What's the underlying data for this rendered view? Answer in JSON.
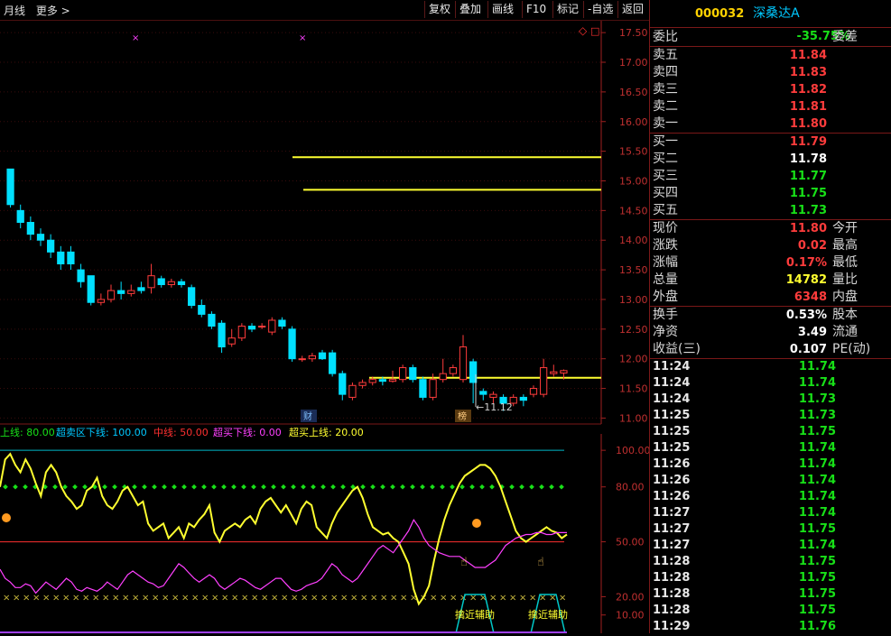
{
  "toolbar": {
    "period": "月线",
    "more": "更多 >",
    "buttons": [
      "复权",
      "叠加",
      "画线",
      "F10",
      "标记",
      "-自选",
      "返回"
    ]
  },
  "stock": {
    "code": "000032",
    "name": "深桑达A"
  },
  "weibi": {
    "label": "委比",
    "value": "-35.75%",
    "label2": "委差"
  },
  "asks": [
    {
      "label": "卖五",
      "price": "11.84"
    },
    {
      "label": "卖四",
      "price": "11.83"
    },
    {
      "label": "卖三",
      "price": "11.82"
    },
    {
      "label": "卖二",
      "price": "11.81"
    },
    {
      "label": "卖一",
      "price": "11.80"
    }
  ],
  "bids": [
    {
      "label": "买一",
      "price": "11.79"
    },
    {
      "label": "买二",
      "price": "11.78"
    },
    {
      "label": "买三",
      "price": "11.77"
    },
    {
      "label": "买四",
      "price": "11.75"
    },
    {
      "label": "买五",
      "price": "11.73"
    }
  ],
  "quote": [
    {
      "label": "现价",
      "value": "11.80",
      "label2": "今开",
      "color": "red"
    },
    {
      "label": "涨跌",
      "value": "0.02",
      "label2": "最高",
      "color": "red"
    },
    {
      "label": "涨幅",
      "value": "0.17%",
      "label2": "最低",
      "color": "red"
    },
    {
      "label": "总量",
      "value": "14782",
      "label2": "量比",
      "color": "yellow"
    },
    {
      "label": "外盘",
      "value": "6348",
      "label2": "内盘",
      "color": "red"
    }
  ],
  "fund": [
    {
      "label": "换手",
      "value": "0.53%",
      "label2": "股本"
    },
    {
      "label": "净资",
      "value": "3.49",
      "label2": "流通"
    },
    {
      "label": "收益(三)",
      "value": "0.107",
      "label2": "PE(动)"
    }
  ],
  "ticks": [
    {
      "time": "11:24",
      "price": "11.74"
    },
    {
      "time": "11:24",
      "price": "11.74"
    },
    {
      "time": "11:24",
      "price": "11.73"
    },
    {
      "time": "11:25",
      "price": "11.73"
    },
    {
      "time": "11:25",
      "price": "11.75"
    },
    {
      "time": "11:25",
      "price": "11.74"
    },
    {
      "time": "11:26",
      "price": "11.74"
    },
    {
      "time": "11:26",
      "price": "11.74"
    },
    {
      "time": "11:26",
      "price": "11.74"
    },
    {
      "time": "11:27",
      "price": "11.74"
    },
    {
      "time": "11:27",
      "price": "11.75"
    },
    {
      "time": "11:27",
      "price": "11.74"
    },
    {
      "time": "11:28",
      "price": "11.75"
    },
    {
      "time": "11:28",
      "price": "11.75"
    },
    {
      "time": "11:28",
      "price": "11.75"
    },
    {
      "time": "11:28",
      "price": "11.75"
    },
    {
      "time": "11:29",
      "price": "11.76"
    }
  ],
  "indicator": {
    "legend": [
      {
        "text": "上线: 80.00",
        "color": "#18e018"
      },
      {
        "text": "超卖区下线: 100.00",
        "color": "#00c8ff"
      },
      {
        "text": "中线: 50.00",
        "color": "#ff3030"
      },
      {
        "text": "超买下线: 0.00",
        "color": "#ff40ff"
      },
      {
        "text": "超买上线: 20.00",
        "color": "#ffff30"
      }
    ],
    "signal_label": "擒近辅助"
  },
  "annotations": {
    "low_price": "←11.12",
    "marker_cai": "财",
    "marker_bang": "榜"
  },
  "chart_data": [
    {
      "type": "candlestick",
      "title": "",
      "yticks": [
        11.0,
        11.5,
        12.0,
        12.5,
        13.0,
        13.5,
        14.0,
        14.5,
        15.0,
        15.5,
        16.0,
        16.5,
        17.0,
        17.5
      ],
      "ylim": [
        10.9,
        17.7
      ],
      "hlines": [
        15.4,
        14.85,
        11.68
      ],
      "candles": [
        [
          15.2,
          14.6,
          15.2,
          14.55
        ],
        [
          14.5,
          14.3,
          14.6,
          14.2
        ],
        [
          14.3,
          14.1,
          14.4,
          14.0
        ],
        [
          14.1,
          14.0,
          14.2,
          13.9
        ],
        [
          14.0,
          13.8,
          14.1,
          13.7
        ],
        [
          13.8,
          13.6,
          13.9,
          13.5
        ],
        [
          13.8,
          13.6,
          13.9,
          13.5
        ],
        [
          13.5,
          13.3,
          13.6,
          13.2
        ],
        [
          13.4,
          12.95,
          13.4,
          12.9
        ],
        [
          12.95,
          13.0,
          13.1,
          12.9
        ],
        [
          13.0,
          13.15,
          13.25,
          12.95
        ],
        [
          13.15,
          13.1,
          13.3,
          13.0
        ],
        [
          13.1,
          13.15,
          13.25,
          13.05
        ],
        [
          13.2,
          13.15,
          13.3,
          13.1
        ],
        [
          13.2,
          13.4,
          13.6,
          13.1
        ],
        [
          13.35,
          13.25,
          13.4,
          13.2
        ],
        [
          13.25,
          13.3,
          13.35,
          13.2
        ],
        [
          13.3,
          13.25,
          13.35,
          13.2
        ],
        [
          13.2,
          12.9,
          13.25,
          12.85
        ],
        [
          12.9,
          12.75,
          13.0,
          12.7
        ],
        [
          12.75,
          12.55,
          12.8,
          12.5
        ],
        [
          12.6,
          12.2,
          12.65,
          12.1
        ],
        [
          12.25,
          12.35,
          12.5,
          12.2
        ],
        [
          12.35,
          12.55,
          12.6,
          12.3
        ],
        [
          12.55,
          12.5,
          12.6,
          12.45
        ],
        [
          12.55,
          12.55,
          12.6,
          12.5
        ],
        [
          12.45,
          12.65,
          12.7,
          12.4
        ],
        [
          12.65,
          12.55,
          12.7,
          12.5
        ],
        [
          12.5,
          12.0,
          12.55,
          11.95
        ],
        [
          12.0,
          12.0,
          12.05,
          11.95
        ],
        [
          12.0,
          12.05,
          12.1,
          11.95
        ],
        [
          12.1,
          12.0,
          12.15,
          11.98
        ],
        [
          12.1,
          11.75,
          12.15,
          11.7
        ],
        [
          11.75,
          11.4,
          11.8,
          11.3
        ],
        [
          11.35,
          11.55,
          11.6,
          11.3
        ],
        [
          11.55,
          11.6,
          11.65,
          11.5
        ],
        [
          11.6,
          11.65,
          11.7,
          11.55
        ],
        [
          11.65,
          11.62,
          11.7,
          11.55
        ],
        [
          11.62,
          11.65,
          11.8,
          11.6
        ],
        [
          11.65,
          11.85,
          11.9,
          11.6
        ],
        [
          11.85,
          11.65,
          11.9,
          11.6
        ],
        [
          11.65,
          11.35,
          11.7,
          11.3
        ],
        [
          11.35,
          11.65,
          11.75,
          11.3
        ],
        [
          11.65,
          11.75,
          12.0,
          11.6
        ],
        [
          11.75,
          11.85,
          11.9,
          11.7
        ],
        [
          11.65,
          12.2,
          12.4,
          11.6
        ],
        [
          11.95,
          11.6,
          12.0,
          11.25
        ],
        [
          11.45,
          11.4,
          11.5,
          11.3
        ],
        [
          11.35,
          11.4,
          11.45,
          11.25
        ],
        [
          11.35,
          11.25,
          11.4,
          11.12
        ],
        [
          11.25,
          11.35,
          11.4,
          11.2
        ],
        [
          11.35,
          11.3,
          11.4,
          11.2
        ],
        [
          11.4,
          11.5,
          11.55,
          11.35
        ],
        [
          11.4,
          11.85,
          12.0,
          11.35
        ],
        [
          11.75,
          11.78,
          11.9,
          11.7
        ],
        [
          11.76,
          11.8,
          11.82,
          11.65
        ]
      ]
    },
    {
      "type": "line",
      "title": "",
      "yticks": [
        10.0,
        20.0,
        50.0,
        80.0,
        100.0
      ],
      "ylim": [
        0,
        105
      ],
      "hlines": [
        100,
        80,
        50,
        20
      ],
      "series": [
        {
          "color": "#ffff30",
          "values": [
            80,
            95,
            98,
            92,
            88,
            95,
            90,
            82,
            75,
            88,
            92,
            88,
            80,
            75,
            72,
            68,
            70,
            78,
            80,
            85,
            75,
            70,
            68,
            72,
            78,
            80,
            75,
            70,
            72,
            60,
            56,
            58,
            60,
            52,
            55,
            58,
            52,
            60,
            58,
            62,
            65,
            70,
            55,
            50,
            56,
            58,
            60,
            58,
            62,
            64,
            60,
            68,
            72,
            74,
            70,
            66,
            70,
            65,
            60,
            68,
            72,
            70,
            58,
            55,
            52,
            60,
            66,
            70,
            74,
            78,
            80,
            74,
            65,
            58,
            56,
            54,
            55,
            52,
            50,
            44,
            38,
            24,
            16,
            20,
            26,
            40,
            52,
            62,
            70,
            76,
            82,
            86,
            88,
            90,
            92,
            92,
            90,
            86,
            80,
            72,
            64,
            56,
            52,
            50,
            52,
            54,
            56,
            58,
            56,
            55,
            52,
            54
          ]
        },
        {
          "color": "#ff40ff",
          "values": [
            35,
            30,
            28,
            25,
            25,
            27,
            26,
            22,
            25,
            28,
            26,
            24,
            27,
            30,
            28,
            24,
            23,
            25,
            24,
            23,
            25,
            28,
            26,
            24,
            28,
            32,
            34,
            32,
            30,
            28,
            27,
            25,
            26,
            30,
            34,
            38,
            36,
            33,
            30,
            28,
            30,
            32,
            30,
            26,
            24,
            26,
            28,
            30,
            29,
            27,
            25,
            24,
            26,
            28,
            30,
            30,
            27,
            24,
            23,
            24,
            26,
            27,
            28,
            30,
            34,
            38,
            36,
            32,
            30,
            28,
            30,
            34,
            38,
            42,
            46,
            48,
            46,
            44,
            48,
            52,
            56,
            62,
            58,
            52,
            48,
            46,
            44,
            43,
            42,
            42,
            42,
            40,
            38,
            36,
            36,
            36,
            38,
            40,
            44,
            48,
            50,
            52,
            53,
            54,
            54,
            55,
            55,
            54,
            54,
            55,
            55,
            55
          ]
        }
      ]
    }
  ]
}
